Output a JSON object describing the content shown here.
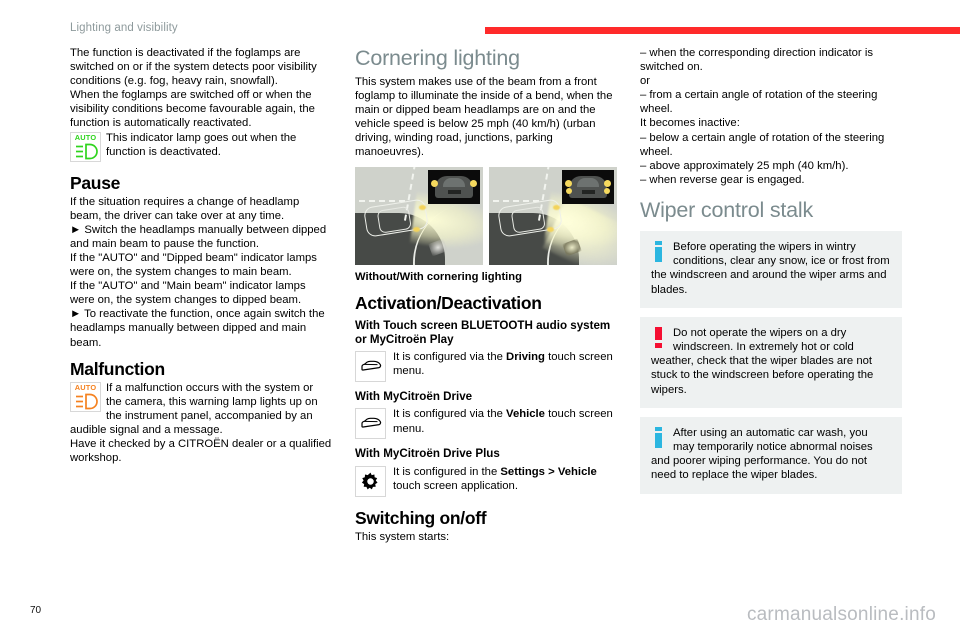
{
  "header": {
    "chapter_title": "Lighting and visibility",
    "rule_color": "#ff2a2a"
  },
  "footer": {
    "page_number": "70",
    "watermark": "carmanualsonline.info"
  },
  "left_column": {
    "intro_paragraph_1": "The function is deactivated if the foglamps are switched on or if the system detects poor visibility conditions (e.g. fog, heavy rain, snowfall).",
    "intro_paragraph_2": "When the foglamps are switched off or when the visibility conditions become favourable again, the function is automatically reactivated.",
    "indicator_lamp_auto_label": "AUTO",
    "indicator_lamp_green_text": "This indicator lamp goes out when the function is deactivated.",
    "pause_heading": "Pause",
    "pause_paragraph_1": "If the situation requires a change of headlamp beam, the driver can take over at any time.",
    "pause_step_1": "►  Switch the headlamps manually between dipped and main beam to pause the function.",
    "pause_paragraph_2": "If the \"AUTO\" and \"Dipped beam\" indicator lamps were on, the system changes to main beam.",
    "pause_paragraph_3": "If the \"AUTO\" and \"Main beam\" indicator lamps were on, the system changes to dipped beam.",
    "pause_step_2": "►  To reactivate the function, once again switch the headlamps manually between dipped and main beam.",
    "malfunction_heading": "Malfunction",
    "malfunction_lamp_text": "If a malfunction occurs with the system or the camera, this warning lamp lights up on the instrument panel, accompanied by an audible signal and a message.",
    "malfunction_paragraph_2": "Have it checked by a CITROËN dealer or a qualified workshop."
  },
  "middle_column": {
    "cornering_heading": "Cornering lighting",
    "cornering_paragraph": "This system makes use of the beam from a front foglamp to illuminate the inside of a bend, when the main or dipped beam headlamps are on and the vehicle speed is below 25 mph (40 km/h) (urban driving, winding road, junctions, parking manoeuvres).",
    "figure_caption": "Without/With cornering lighting",
    "activation_heading": "Activation/Deactivation",
    "sub_heading_1": "With Touch screen BLUETOOTH audio system or MyCitroën Play",
    "config_text_1_pre": "It is configured via the ",
    "config_text_1_bold": "Driving",
    "config_text_1_post": " touch screen menu.",
    "sub_heading_2": "With MyCitroën Drive",
    "config_text_2_pre": "It is configured via the ",
    "config_text_2_bold": "Vehicle",
    "config_text_2_post": " touch screen menu.",
    "sub_heading_3": "With MyCitroën Drive Plus",
    "config_text_3_pre": "It is configured in the ",
    "config_text_3_bold": "Settings > Vehicle",
    "config_text_3_post": " touch screen application.",
    "switching_heading": "Switching on/off",
    "switching_paragraph": "This system starts:"
  },
  "right_column": {
    "bullet_1": "–  when the corresponding direction indicator is switched on.",
    "or_text": "or",
    "bullet_2": "–  from a certain angle of rotation of the steering wheel.",
    "inactive_intro": "It becomes inactive:",
    "bullet_3": "–  below a certain angle of rotation of the steering wheel.",
    "bullet_4": "–  above approximately 25 mph (40 km/h).",
    "bullet_5": "–  when reverse gear is engaged.",
    "wiper_heading": "Wiper control stalk",
    "note_1": "Before operating the wipers in wintry conditions, clear any snow, ice or frost from the windscreen and around the wiper arms and blades.",
    "note_2": "Do not operate the wipers on a dry windscreen. In extremely hot or cold weather, check that the wiper blades are not stuck to the windscreen before operating the wipers.",
    "note_3": "After using an automatic car wash, you may temporarily notice abnormal noises and poorer wiping performance.  You do not need to replace the wiper blades."
  },
  "colors": {
    "header_rule": "#ff2a2a",
    "heading_grey": "#7b8b8e",
    "lamp_green": "#2fd41e",
    "lamp_orange": "#f58220",
    "note_info_blue": "#2bb6e0",
    "note_warning_red": "#f50f32",
    "note_background": "#eef1f1"
  }
}
